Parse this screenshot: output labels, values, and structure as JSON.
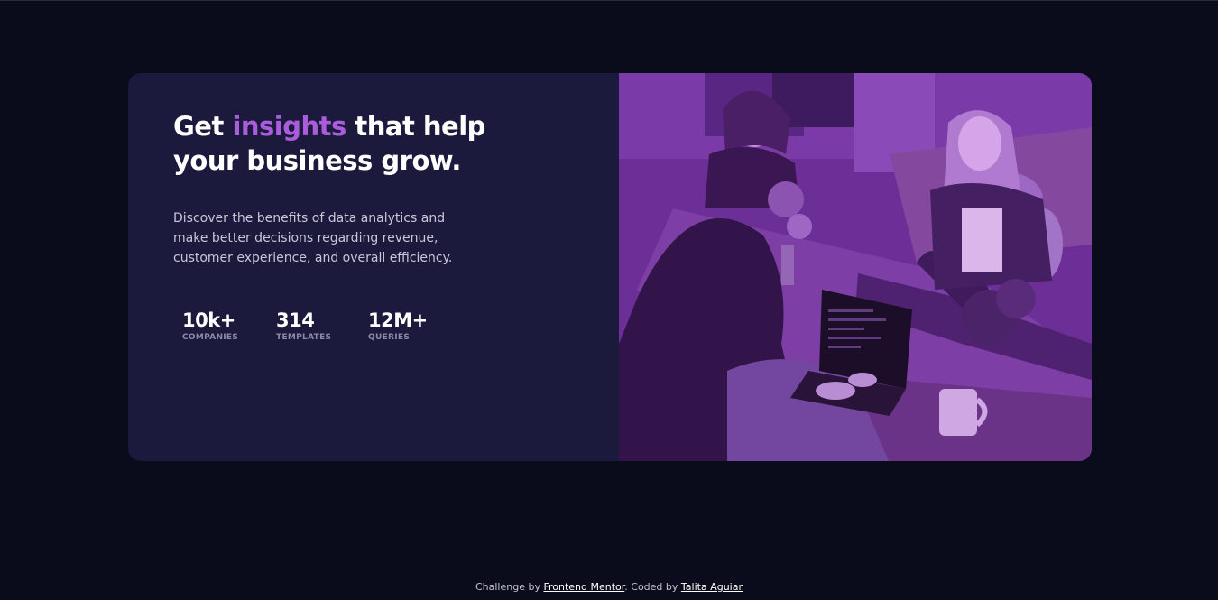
{
  "card": {
    "headline_pre": "Get ",
    "headline_accent": "insights",
    "headline_post": " that help your business grow.",
    "description": "Discover the benefits of data analytics and make better decisions regarding revenue, customer experience, and overall efficiency.",
    "stats": [
      {
        "value": "10k+",
        "label": "COMPANIES"
      },
      {
        "value": "314",
        "label": "TEMPLATES"
      },
      {
        "value": "12M+",
        "label": "QUERIES"
      }
    ]
  },
  "footer": {
    "prefix": "Challenge by ",
    "challenge_link": "Frontend Mentor",
    "middle": ". Coded by ",
    "author_link": "Talita Aguiar"
  },
  "colors": {
    "background": "#0a0c1c",
    "card": "#1c1a3c",
    "accent": "#a95ddb",
    "image_overlay": "#6a2d96"
  }
}
